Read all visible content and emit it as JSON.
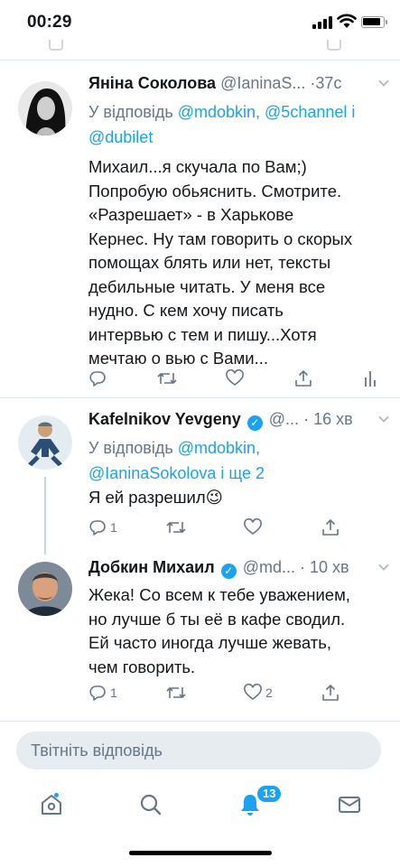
{
  "status_bar": {
    "time": "00:29",
    "battery_level": 0.9
  },
  "reply_prefix": "У відповідь",
  "tweets": [
    {
      "name": "Яніна Соколова",
      "handle": "@IaninaS...",
      "dot": "·",
      "ago": "37с",
      "reply_mentions_line1": "@mdobkin, @5channel і",
      "reply_mentions_line2": "@dubilet",
      "text": "Михаил...я скучала по Вам;)\nПопробую обьяснить. Смотрите.\n«Разрешает» - в Харькове\nКернес. Ну там говорить о скорых\nпомощах блять или нет, тексты\nдебильные читать. У меня все\nнудно. С кем хочу писать\nинтервью с тем и пишу...Хотя\nмечтаю о вью с Вами...",
      "replies": "",
      "likes": ""
    },
    {
      "name": "Kafelnikov Yevgeny",
      "handle": "@...",
      "dot": "·",
      "ago": "16 хв",
      "reply_mentions_line1": "@mdobkin,",
      "reply_mentions_line2": "@IaninaSokolova і ще 2",
      "text": "Я ей разрешил😉",
      "replies": "1",
      "likes": ""
    },
    {
      "name": "Добкин Михаил",
      "handle": "@md...",
      "dot": "·",
      "ago": "10 хв",
      "text": "Жека! Со всем к тебе уважением,\nно лучше б ты её в кафе сводил.\nЕй часто иногда лучше жевать,\nчем говорить.",
      "replies": "1",
      "likes": "2"
    }
  ],
  "reply_box": {
    "placeholder": "Твітніть відповідь"
  },
  "tabbar": {
    "items": [
      "home-icon",
      "search-icon",
      "notifications-icon",
      "messages-icon"
    ],
    "notifications_badge": "13"
  },
  "colors": {
    "accent": "#1da1f2",
    "muted": "#657786",
    "text": "#14171a",
    "divider": "#e1e8ed"
  }
}
